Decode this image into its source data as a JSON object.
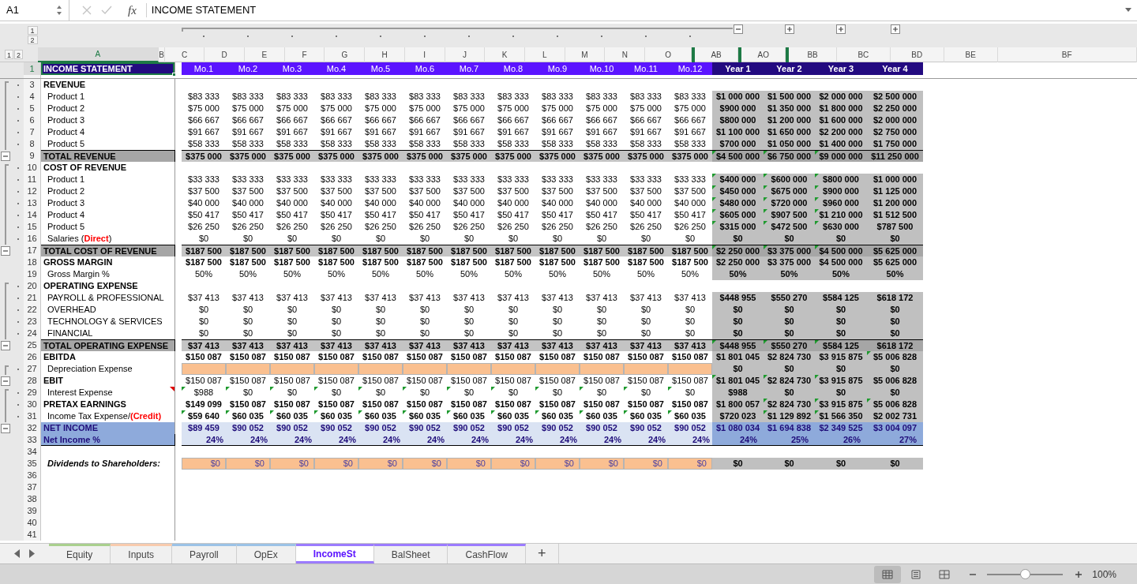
{
  "formula_bar": {
    "name_box": "A1",
    "function_label": "fx",
    "formula": "INCOME STATEMENT"
  },
  "outline_levels": {
    "rows": [
      "1",
      "2"
    ],
    "columns": [
      "1",
      "2"
    ]
  },
  "column_outline": [
    {
      "kind": "collapse"
    },
    {
      "kind": "expand"
    },
    {
      "kind": "expand"
    },
    {
      "kind": "expand"
    }
  ],
  "columns": [
    {
      "label": "A",
      "selected": true
    },
    {
      "label": "B",
      "selected": false
    },
    {
      "label": "C",
      "selected": false
    },
    {
      "label": "D",
      "selected": false
    },
    {
      "label": "E",
      "selected": false
    },
    {
      "label": "F",
      "selected": false
    },
    {
      "label": "G",
      "selected": false
    },
    {
      "label": "H",
      "selected": false
    },
    {
      "label": "I",
      "selected": false
    },
    {
      "label": "J",
      "selected": false
    },
    {
      "label": "K",
      "selected": false
    },
    {
      "label": "L",
      "selected": false
    },
    {
      "label": "M",
      "selected": false
    },
    {
      "label": "N",
      "selected": false
    },
    {
      "label": "O",
      "selected": false,
      "hidden_before": false
    },
    {
      "label": "AB",
      "selected": false,
      "hidden_before": true
    },
    {
      "label": "AO",
      "selected": false,
      "hidden_before": true
    },
    {
      "label": "BB",
      "selected": false,
      "hidden_before": true
    },
    {
      "label": "BC",
      "selected": false
    },
    {
      "label": "BD",
      "selected": false
    },
    {
      "label": "BE",
      "selected": false
    },
    {
      "label": "BF",
      "selected": false
    }
  ],
  "rows": [
    {
      "num": "1",
      "kind": "title",
      "label": "INCOME STATEMENT",
      "selected": true,
      "months": [
        "Mo.1",
        "Mo.2",
        "Mo.3",
        "Mo.4",
        "Mo.5",
        "Mo.6",
        "Mo.7",
        "Mo.8",
        "Mo.9",
        "Mo.10",
        "Mo.11",
        "Mo.12"
      ],
      "years": [
        "Year 1",
        "Year 2",
        "Year 3",
        "Year 4"
      ]
    },
    {
      "kind": "spacer"
    },
    {
      "num": "3",
      "kind": "section",
      "grouped": true,
      "group_start": true,
      "label": "REVENUE"
    },
    {
      "num": "4",
      "kind": "item",
      "grouped": true,
      "label": "Product 1",
      "bold": false,
      "months": [
        "$83 333",
        "$83 333",
        "$83 333",
        "$83 333",
        "$83 333",
        "$83 333",
        "$83 333",
        "$83 333",
        "$83 333",
        "$83 333",
        "$83 333",
        "$83 333"
      ],
      "years": [
        "$1 000 000",
        "$1 500 000",
        "$2 000 000",
        "$2 500 000"
      ]
    },
    {
      "num": "5",
      "kind": "item",
      "grouped": true,
      "label": "Product 2",
      "bold": false,
      "months": [
        "$75 000",
        "$75 000",
        "$75 000",
        "$75 000",
        "$75 000",
        "$75 000",
        "$75 000",
        "$75 000",
        "$75 000",
        "$75 000",
        "$75 000",
        "$75 000"
      ],
      "years": [
        "$900 000",
        "$1 350 000",
        "$1 800 000",
        "$2 250 000"
      ]
    },
    {
      "num": "6",
      "kind": "item",
      "grouped": true,
      "label": "Product 3",
      "bold": false,
      "months": [
        "$66 667",
        "$66 667",
        "$66 667",
        "$66 667",
        "$66 667",
        "$66 667",
        "$66 667",
        "$66 667",
        "$66 667",
        "$66 667",
        "$66 667",
        "$66 667"
      ],
      "years": [
        "$800 000",
        "$1 200 000",
        "$1 600 000",
        "$2 000 000"
      ]
    },
    {
      "num": "7",
      "kind": "item",
      "grouped": true,
      "label": "Product 4",
      "bold": false,
      "months": [
        "$91 667",
        "$91 667",
        "$91 667",
        "$91 667",
        "$91 667",
        "$91 667",
        "$91 667",
        "$91 667",
        "$91 667",
        "$91 667",
        "$91 667",
        "$91 667"
      ],
      "years": [
        "$1 100 000",
        "$1 650 000",
        "$2 200 000",
        "$2 750 000"
      ]
    },
    {
      "num": "8",
      "kind": "item",
      "grouped": true,
      "label": "Product 5",
      "bold": false,
      "months": [
        "$58 333",
        "$58 333",
        "$58 333",
        "$58 333",
        "$58 333",
        "$58 333",
        "$58 333",
        "$58 333",
        "$58 333",
        "$58 333",
        "$58 333",
        "$58 333"
      ],
      "years": [
        "$700 000",
        "$1 050 000",
        "$1 400 000",
        "$1 750 000"
      ]
    },
    {
      "num": "9",
      "kind": "total",
      "collapse_button": true,
      "label": "TOTAL REVENUE",
      "bold": true,
      "months": [
        "$375 000",
        "$375 000",
        "$375 000",
        "$375 000",
        "$375 000",
        "$375 000",
        "$375 000",
        "$375 000",
        "$375 000",
        "$375 000",
        "$375 000",
        "$375 000"
      ],
      "years": [
        "$4 500 000",
        "$6 750 000",
        "$9 000 000",
        "$11 250 000"
      ],
      "year_flags": [
        true,
        true,
        true,
        false
      ]
    },
    {
      "num": "10",
      "kind": "section",
      "grouped": true,
      "group_start": true,
      "label": "COST OF REVENUE"
    },
    {
      "num": "11",
      "kind": "item",
      "grouped": true,
      "label": "Product 1",
      "bold": false,
      "months": [
        "$33 333",
        "$33 333",
        "$33 333",
        "$33 333",
        "$33 333",
        "$33 333",
        "$33 333",
        "$33 333",
        "$33 333",
        "$33 333",
        "$33 333",
        "$33 333"
      ],
      "years": [
        "$400 000",
        "$600 000",
        "$800 000",
        "$1 000 000"
      ],
      "year_flags": [
        true,
        true,
        true,
        false
      ]
    },
    {
      "num": "12",
      "kind": "item",
      "grouped": true,
      "label": "Product 2",
      "bold": false,
      "months": [
        "$37 500",
        "$37 500",
        "$37 500",
        "$37 500",
        "$37 500",
        "$37 500",
        "$37 500",
        "$37 500",
        "$37 500",
        "$37 500",
        "$37 500",
        "$37 500"
      ],
      "years": [
        "$450 000",
        "$675 000",
        "$900 000",
        "$1 125 000"
      ],
      "year_flags": [
        true,
        true,
        true,
        false
      ]
    },
    {
      "num": "13",
      "kind": "item",
      "grouped": true,
      "label": "Product 3",
      "bold": false,
      "months": [
        "$40 000",
        "$40 000",
        "$40 000",
        "$40 000",
        "$40 000",
        "$40 000",
        "$40 000",
        "$40 000",
        "$40 000",
        "$40 000",
        "$40 000",
        "$40 000"
      ],
      "years": [
        "$480 000",
        "$720 000",
        "$960 000",
        "$1 200 000"
      ],
      "year_flags": [
        true,
        true,
        true,
        false
      ]
    },
    {
      "num": "14",
      "kind": "item",
      "grouped": true,
      "label": "Product 4",
      "bold": false,
      "months": [
        "$50 417",
        "$50 417",
        "$50 417",
        "$50 417",
        "$50 417",
        "$50 417",
        "$50 417",
        "$50 417",
        "$50 417",
        "$50 417",
        "$50 417",
        "$50 417"
      ],
      "years": [
        "$605 000",
        "$907 500",
        "$1 210 000",
        "$1 512 500"
      ],
      "year_flags": [
        true,
        true,
        true,
        false
      ]
    },
    {
      "num": "15",
      "kind": "item",
      "grouped": true,
      "label": "Product 5",
      "bold": false,
      "months": [
        "$26 250",
        "$26 250",
        "$26 250",
        "$26 250",
        "$26 250",
        "$26 250",
        "$26 250",
        "$26 250",
        "$26 250",
        "$26 250",
        "$26 250",
        "$26 250"
      ],
      "years": [
        "$315 000",
        "$472 500",
        "$630 000",
        "$787 500"
      ],
      "year_flags": [
        true,
        true,
        true,
        false
      ]
    },
    {
      "num": "16",
      "kind": "item",
      "grouped": true,
      "label_parts": [
        {
          "text": "Salaries (",
          "red": false
        },
        {
          "text": "Direct",
          "red": true
        },
        {
          "text": ")",
          "red": false
        }
      ],
      "bold": false,
      "months": [
        "$0",
        "$0",
        "$0",
        "$0",
        "$0",
        "$0",
        "$0",
        "$0",
        "$0",
        "$0",
        "$0",
        "$0"
      ],
      "years": [
        "$0",
        "$0",
        "$0",
        "$0"
      ]
    },
    {
      "num": "17",
      "kind": "total",
      "collapse_button": true,
      "label": "TOTAL COST OF REVENUE",
      "bold": true,
      "months": [
        "$187 500",
        "$187 500",
        "$187 500",
        "$187 500",
        "$187 500",
        "$187 500",
        "$187 500",
        "$187 500",
        "$187 500",
        "$187 500",
        "$187 500",
        "$187 500"
      ],
      "years": [
        "$2 250 000",
        "$3 375 000",
        "$4 500 000",
        "$5 625 000"
      ],
      "year_flags": [
        true,
        true,
        true,
        false
      ]
    },
    {
      "num": "18",
      "kind": "subtotal",
      "label": "GROSS MARGIN",
      "bold": true,
      "months": [
        "$187 500",
        "$187 500",
        "$187 500",
        "$187 500",
        "$187 500",
        "$187 500",
        "$187 500",
        "$187 500",
        "$187 500",
        "$187 500",
        "$187 500",
        "$187 500"
      ],
      "years": [
        "$2 250 000",
        "$3 375 000",
        "$4 500 000",
        "$5 625 000"
      ]
    },
    {
      "num": "19",
      "kind": "item",
      "label": "Gross Margin %",
      "bold": false,
      "months": [
        "50%",
        "50%",
        "50%",
        "50%",
        "50%",
        "50%",
        "50%",
        "50%",
        "50%",
        "50%",
        "50%",
        "50%"
      ],
      "years": [
        "50%",
        "50%",
        "50%",
        "50%"
      ]
    },
    {
      "num": "20",
      "kind": "section",
      "grouped": true,
      "group_start": true,
      "label": "OPERATING EXPENSE"
    },
    {
      "num": "21",
      "kind": "item",
      "grouped": true,
      "label": "PAYROLL & PROFESSIONAL",
      "bold": false,
      "months": [
        "$37 413",
        "$37 413",
        "$37 413",
        "$37 413",
        "$37 413",
        "$37 413",
        "$37 413",
        "$37 413",
        "$37 413",
        "$37 413",
        "$37 413",
        "$37 413"
      ],
      "years": [
        "$448 955",
        "$550 270",
        "$584 125",
        "$618 172"
      ]
    },
    {
      "num": "22",
      "kind": "item",
      "grouped": true,
      "label": "OVERHEAD",
      "bold": false,
      "months": [
        "$0",
        "$0",
        "$0",
        "$0",
        "$0",
        "$0",
        "$0",
        "$0",
        "$0",
        "$0",
        "$0",
        "$0"
      ],
      "years": [
        "$0",
        "$0",
        "$0",
        "$0"
      ]
    },
    {
      "num": "23",
      "kind": "item",
      "grouped": true,
      "label": "TECHNOLOGY & SERVICES",
      "bold": false,
      "months": [
        "$0",
        "$0",
        "$0",
        "$0",
        "$0",
        "$0",
        "$0",
        "$0",
        "$0",
        "$0",
        "$0",
        "$0"
      ],
      "years": [
        "$0",
        "$0",
        "$0",
        "$0"
      ]
    },
    {
      "num": "24",
      "kind": "item",
      "grouped": true,
      "label": "FINANCIAL",
      "bold": false,
      "months": [
        "$0",
        "$0",
        "$0",
        "$0",
        "$0",
        "$0",
        "$0",
        "$0",
        "$0",
        "$0",
        "$0",
        "$0"
      ],
      "years": [
        "$0",
        "$0",
        "$0",
        "$0"
      ]
    },
    {
      "num": "25",
      "kind": "total",
      "collapse_button": true,
      "label": "TOTAL OPERATING EXPENSE",
      "bold": true,
      "months": [
        "$37 413",
        "$37 413",
        "$37 413",
        "$37 413",
        "$37 413",
        "$37 413",
        "$37 413",
        "$37 413",
        "$37 413",
        "$37 413",
        "$37 413",
        "$37 413"
      ],
      "years": [
        "$448 955",
        "$550 270",
        "$584 125",
        "$618 172"
      ],
      "year_flags": [
        true,
        true,
        true,
        false
      ]
    },
    {
      "num": "26",
      "kind": "subtotal",
      "label": "EBITDA",
      "bold": true,
      "months": [
        "$150 087",
        "$150 087",
        "$150 087",
        "$150 087",
        "$150 087",
        "$150 087",
        "$150 087",
        "$150 087",
        "$150 087",
        "$150 087",
        "$150 087",
        "$150 087"
      ],
      "years": [
        "$1 801 045",
        "$2 824 730",
        "$3 915 875",
        "$5 006 828"
      ],
      "year_flags": [
        false,
        false,
        false,
        true
      ]
    },
    {
      "num": "27",
      "kind": "input",
      "grouped": true,
      "group_start": true,
      "label": "Depreciation Expense",
      "years": [
        "$0",
        "$0",
        "$0",
        "$0"
      ]
    },
    {
      "num": "28",
      "kind": "subtotal",
      "collapse_button": true,
      "label": "EBIT",
      "bold": false,
      "months": [
        "$150 087",
        "$150 087",
        "$150 087",
        "$150 087",
        "$150 087",
        "$150 087",
        "$150 087",
        "$150 087",
        "$150 087",
        "$150 087",
        "$150 087",
        "$150 087"
      ],
      "years": [
        "$1 801 045",
        "$2 824 730",
        "$3 915 875",
        "$5 006 828"
      ],
      "year_flags": [
        true,
        true,
        true,
        false
      ]
    },
    {
      "num": "29",
      "kind": "item",
      "grouped": true,
      "group_start": true,
      "label": "Interest Expense",
      "comment": true,
      "bold": false,
      "months": [
        "$988",
        "$0",
        "$0",
        "$0",
        "$0",
        "$0",
        "$0",
        "$0",
        "$0",
        "$0",
        "$0",
        "$0"
      ],
      "month_flags": true,
      "years": [
        "$988",
        "$0",
        "$0",
        "$0"
      ]
    },
    {
      "num": "30",
      "kind": "subtotal",
      "grouped": true,
      "label": "PRETAX EARNINGS",
      "bold": true,
      "months": [
        "$149 099",
        "$150 087",
        "$150 087",
        "$150 087",
        "$150 087",
        "$150 087",
        "$150 087",
        "$150 087",
        "$150 087",
        "$150 087",
        "$150 087",
        "$150 087"
      ],
      "years": [
        "$1 800 057",
        "$2 824 730",
        "$3 915 875",
        "$5 006 828"
      ],
      "year_flags": [
        false,
        true,
        true,
        true
      ]
    },
    {
      "num": "31",
      "kind": "item",
      "grouped": true,
      "label_parts": [
        {
          "text": "Income Tax Expense/",
          "red": false
        },
        {
          "text": "(Credit)",
          "red": true
        }
      ],
      "bold": true,
      "months": [
        "$59 640",
        "$60 035",
        "$60 035",
        "$60 035",
        "$60 035",
        "$60 035",
        "$60 035",
        "$60 035",
        "$60 035",
        "$60 035",
        "$60 035",
        "$60 035"
      ],
      "month_flags": true,
      "years": [
        "$720 023",
        "$1 129 892",
        "$1 566 350",
        "$2 002 731"
      ],
      "year_flags": [
        false,
        true,
        true,
        false
      ]
    },
    {
      "num": "32",
      "kind": "net",
      "collapse_button": true,
      "label": "NET INCOME",
      "bold": true,
      "months": [
        "$89 459",
        "$90 052",
        "$90 052",
        "$90 052",
        "$90 052",
        "$90 052",
        "$90 052",
        "$90 052",
        "$90 052",
        "$90 052",
        "$90 052",
        "$90 052"
      ],
      "years": [
        "$1 080 034",
        "$1 694 838",
        "$2 349 525",
        "$3 004 097"
      ]
    },
    {
      "num": "33",
      "kind": "net_pct",
      "label": "Net Income %",
      "bold": true,
      "months": [
        "24%",
        "24%",
        "24%",
        "24%",
        "24%",
        "24%",
        "24%",
        "24%",
        "24%",
        "24%",
        "24%",
        "24%"
      ],
      "years": [
        "24%",
        "25%",
        "26%",
        "27%"
      ]
    },
    {
      "num": "34",
      "kind": "blank"
    },
    {
      "num": "35",
      "kind": "dividend",
      "label": "Dividends to Shareholders:",
      "bold": false,
      "months": [
        "$0",
        "$0",
        "$0",
        "$0",
        "$0",
        "$0",
        "$0",
        "$0",
        "$0",
        "$0",
        "$0",
        "$0"
      ],
      "years": [
        "$0",
        "$0",
        "$0",
        "$0"
      ]
    },
    {
      "num": "36",
      "kind": "blank"
    },
    {
      "num": "37",
      "kind": "blank"
    },
    {
      "num": "38",
      "kind": "blank"
    },
    {
      "num": "39",
      "kind": "blank"
    },
    {
      "num": "40",
      "kind": "blank"
    },
    {
      "num": "41",
      "kind": "blank"
    }
  ],
  "sheet_tabs": [
    {
      "label": "Equity",
      "color": "#a9d08e",
      "selected": false
    },
    {
      "label": "Inputs",
      "color": "#f8cbad",
      "selected": false
    },
    {
      "label": "Payroll",
      "color": "#9bc2e6",
      "selected": false
    },
    {
      "label": "OpEx",
      "color": "#9bc2e6",
      "selected": false
    },
    {
      "label": "IncomeSt",
      "color": "#9b7bff",
      "selected": true
    },
    {
      "label": "BalSheet",
      "color": "#9b7bff",
      "selected": false
    },
    {
      "label": "CashFlow",
      "color": "#9b7bff",
      "selected": false
    }
  ],
  "add_sheet": "+",
  "status_bar": {
    "views": [
      {
        "kind": "normal",
        "selected": true
      },
      {
        "kind": "layout",
        "selected": false
      },
      {
        "kind": "break",
        "selected": false
      }
    ],
    "zoom_slider": {
      "level": 0.5
    },
    "zoom": "100%"
  }
}
